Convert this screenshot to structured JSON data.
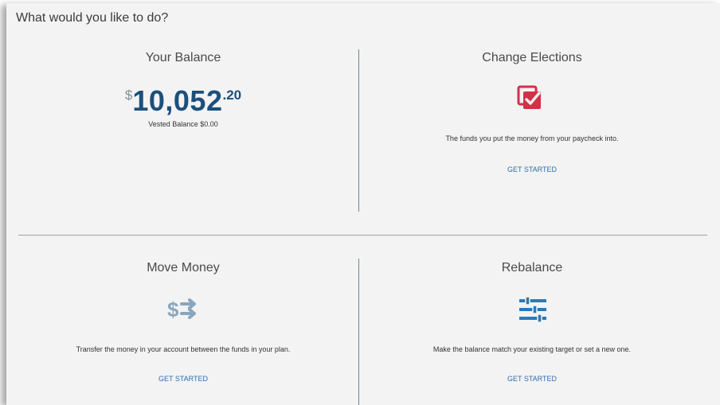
{
  "heading": "What would you like to do?",
  "balance_card": {
    "title": "Your Balance",
    "currency": "$",
    "whole": "10,052",
    "cents": ".20",
    "vested": "Vested Balance $0.00"
  },
  "elections_card": {
    "title": "Change Elections",
    "icon": "checklist-icon",
    "description": "The funds you put the money from your paycheck into.",
    "cta": "GET STARTED",
    "icon_color": "#d23147"
  },
  "move_card": {
    "title": "Move Money",
    "icon": "dollar-transfer-icon",
    "description": "Transfer the money in your account between the funds in your plan.",
    "cta": "GET STARTED",
    "icon_color": "#8aa6bd"
  },
  "rebalance_card": {
    "title": "Rebalance",
    "icon": "sliders-icon",
    "description": "Make the balance match your existing target or set a new one.",
    "cta": "GET STARTED",
    "icon_color": "#2d79b8"
  },
  "colors": {
    "accent": "#1c4f7c",
    "link": "#2b6fae",
    "background": "#f3f3f3",
    "divider": "#8fa8ba"
  }
}
